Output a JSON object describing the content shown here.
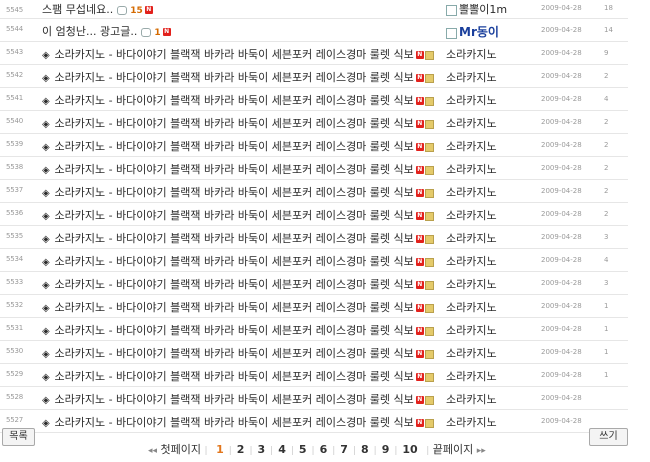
{
  "posts": [
    {
      "no": "5545",
      "subject": "스팸 무섭네요..",
      "comments": "15",
      "new": true,
      "author": "뽈뽈이1m",
      "date": "2009-04-28",
      "hits": "18",
      "bullet": false
    },
    {
      "no": "5544",
      "subject": "이 엄청난... 광고글..",
      "comments": "1",
      "new": true,
      "author": "Mr동이",
      "date": "2009-04-28",
      "hits": "14",
      "bullet": false
    },
    {
      "no": "5543",
      "subject": "소라카지노 - 바다이야기 블랙잭 바카라 바둑이 세븐포커 레이스경마 룰렛 식보",
      "author": "소라카지노",
      "date": "2009-04-28",
      "hits": "9",
      "bullet": true
    },
    {
      "no": "5542",
      "subject": "소라카지노 - 바다이야기 블랙잭 바카라 바둑이 세븐포커 레이스경마 룰렛 식보",
      "author": "소라카지노",
      "date": "2009-04-28",
      "hits": "2",
      "bullet": true
    },
    {
      "no": "5541",
      "subject": "소라카지노 - 바다이야기 블랙잭 바카라 바둑이 세븐포커 레이스경마 룰렛 식보",
      "author": "소라카지노",
      "date": "2009-04-28",
      "hits": "4",
      "bullet": true
    },
    {
      "no": "5540",
      "subject": "소라카지노 - 바다이야기 블랙잭 바카라 바둑이 세븐포커 레이스경마 룰렛 식보",
      "author": "소라카지노",
      "date": "2009-04-28",
      "hits": "2",
      "bullet": true
    },
    {
      "no": "5539",
      "subject": "소라카지노 - 바다이야기 블랙잭 바카라 바둑이 세븐포커 레이스경마 룰렛 식보",
      "author": "소라카지노",
      "date": "2009-04-28",
      "hits": "2",
      "bullet": true
    },
    {
      "no": "5538",
      "subject": "소라카지노 - 바다이야기 블랙잭 바카라 바둑이 세븐포커 레이스경마 룰렛 식보",
      "author": "소라카지노",
      "date": "2009-04-28",
      "hits": "2",
      "bullet": true
    },
    {
      "no": "5537",
      "subject": "소라카지노 - 바다이야기 블랙잭 바카라 바둑이 세븐포커 레이스경마 룰렛 식보",
      "author": "소라카지노",
      "date": "2009-04-28",
      "hits": "2",
      "bullet": true
    },
    {
      "no": "5536",
      "subject": "소라카지노 - 바다이야기 블랙잭 바카라 바둑이 세븐포커 레이스경마 룰렛 식보",
      "author": "소라카지노",
      "date": "2009-04-28",
      "hits": "2",
      "bullet": true
    },
    {
      "no": "5535",
      "subject": "소라카지노 - 바다이야기 블랙잭 바카라 바둑이 세븐포커 레이스경마 룰렛 식보",
      "author": "소라카지노",
      "date": "2009-04-28",
      "hits": "3",
      "bullet": true
    },
    {
      "no": "5534",
      "subject": "소라카지노 - 바다이야기 블랙잭 바카라 바둑이 세븐포커 레이스경마 룰렛 식보",
      "author": "소라카지노",
      "date": "2009-04-28",
      "hits": "4",
      "bullet": true
    },
    {
      "no": "5533",
      "subject": "소라카지노 - 바다이야기 블랙잭 바카라 바둑이 세븐포커 레이스경마 룰렛 식보",
      "author": "소라카지노",
      "date": "2009-04-28",
      "hits": "3",
      "bullet": true
    },
    {
      "no": "5532",
      "subject": "소라카지노 - 바다이야기 블랙잭 바카라 바둑이 세븐포커 레이스경마 룰렛 식보",
      "author": "소라카지노",
      "date": "2009-04-28",
      "hits": "1",
      "bullet": true
    },
    {
      "no": "5531",
      "subject": "소라카지노 - 바다이야기 블랙잭 바카라 바둑이 세븐포커 레이스경마 룰렛 식보",
      "author": "소라카지노",
      "date": "2009-04-28",
      "hits": "1",
      "bullet": true
    },
    {
      "no": "5530",
      "subject": "소라카지노 - 바다이야기 블랙잭 바카라 바둑이 세븐포커 레이스경마 룰렛 식보",
      "author": "소라카지노",
      "date": "2009-04-28",
      "hits": "1",
      "bullet": true
    },
    {
      "no": "5529",
      "subject": "소라카지노 - 바다이야기 블랙잭 바카라 바둑이 세븐포커 레이스경마 룰렛 식보",
      "author": "소라카지노",
      "date": "2009-04-28",
      "hits": "1",
      "bullet": true
    },
    {
      "no": "5528",
      "subject": "소라카지노 - 바다이야기 블랙잭 바카라 바둑이 세븐포커 레이스경마 룰렛 식보",
      "author": "소라카지노",
      "date": "2009-04-28",
      "hits": "",
      "bullet": true
    },
    {
      "no": "5527",
      "subject": "소라카지노 - 바다이야기 블랙잭 바카라 바둑이 세븐포커 레이스경마 룰렛 식보",
      "author": "소라카지노",
      "date": "2009-04-28",
      "hits": "",
      "bullet": true
    }
  ],
  "buttons": {
    "list": "목록",
    "write": "쓰기"
  },
  "pager": {
    "first": "첫페이지",
    "last": "끝페이지",
    "pages": [
      "1",
      "2",
      "3",
      "4",
      "5",
      "6",
      "7",
      "8",
      "9",
      "10"
    ],
    "current": "1"
  },
  "icons": {
    "bullet": "◈",
    "new": "N"
  }
}
